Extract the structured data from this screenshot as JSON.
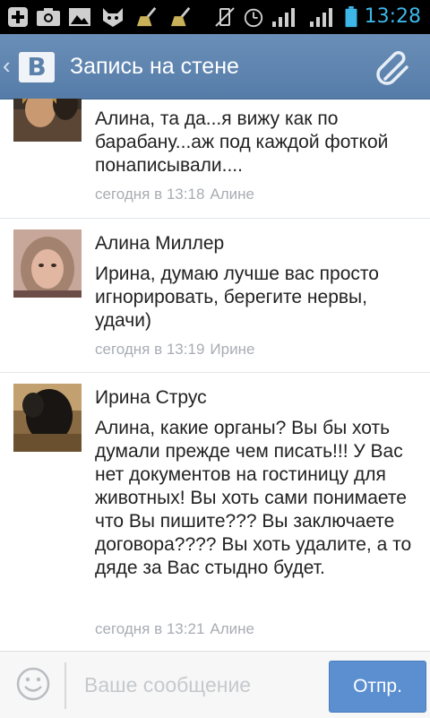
{
  "status_bar": {
    "time": "13:28",
    "icons": [
      "add-icon",
      "camera-icon",
      "image-icon",
      "cat-icon",
      "broom-icon",
      "broom-icon",
      "vibrate-icon",
      "alarm-icon",
      "signal-icon",
      "signal-icon",
      "battery-icon"
    ]
  },
  "header": {
    "title": "Запись на стене",
    "logo_letter": "B",
    "back_symbol": "‹"
  },
  "comments": [
    {
      "author": "",
      "text": "Алина, та да...я вижу как по барабану...аж под каждой фоткой понаписывали....",
      "time": "сегодня в 13:18",
      "reply_to": "Алине"
    },
    {
      "author": "Алина Миллер",
      "text": "Ирина, думаю лучше вас просто игнорировать, берегите нервы, удачи)",
      "time": "сегодня в 13:19",
      "reply_to": "Ирине"
    },
    {
      "author": "Ирина Струс",
      "text": "Алина, какие органы? Вы бы хоть думали прежде чем писать!!! У Вас нет документов на гостиницу для животных! Вы хоть сами понимаете что Вы пишите??? Вы заключаете договора???? Вы хоть удалите, а то дяде за Вас стыдно будет.",
      "time": "сегодня в 13:21",
      "reply_to": "Алине"
    }
  ],
  "composer": {
    "placeholder": "Ваше сообщение",
    "send_label": "Отпр."
  },
  "colors": {
    "header": "#5a80ab",
    "send_button": "#5b8fd0",
    "clock": "#3db7e8"
  }
}
